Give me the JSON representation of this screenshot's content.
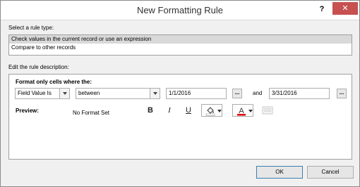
{
  "window": {
    "title": "New Formatting Rule",
    "help_label": "?",
    "close_label": "✕"
  },
  "rule_type": {
    "label": "Select a rule type:",
    "options": [
      "Check values in the current record or use an expression",
      "Compare to other records"
    ],
    "selected_index": 0
  },
  "description": {
    "label": "Edit the rule description:",
    "format_label": "Format only cells where the:",
    "field_combo_value": "Field Value Is",
    "operator_combo_value": "between",
    "value1": "1/1/2016",
    "and_label": "and",
    "value2": "3/31/2016",
    "ellipsis_label": "...",
    "preview_label": "Preview:",
    "preview_text": "No Format Set",
    "bold_label": "B",
    "italic_label": "I",
    "underline_label": "U",
    "fill_color": "#ffffff",
    "font_color": "#e00000"
  },
  "buttons": {
    "ok": "OK",
    "cancel": "Cancel"
  }
}
